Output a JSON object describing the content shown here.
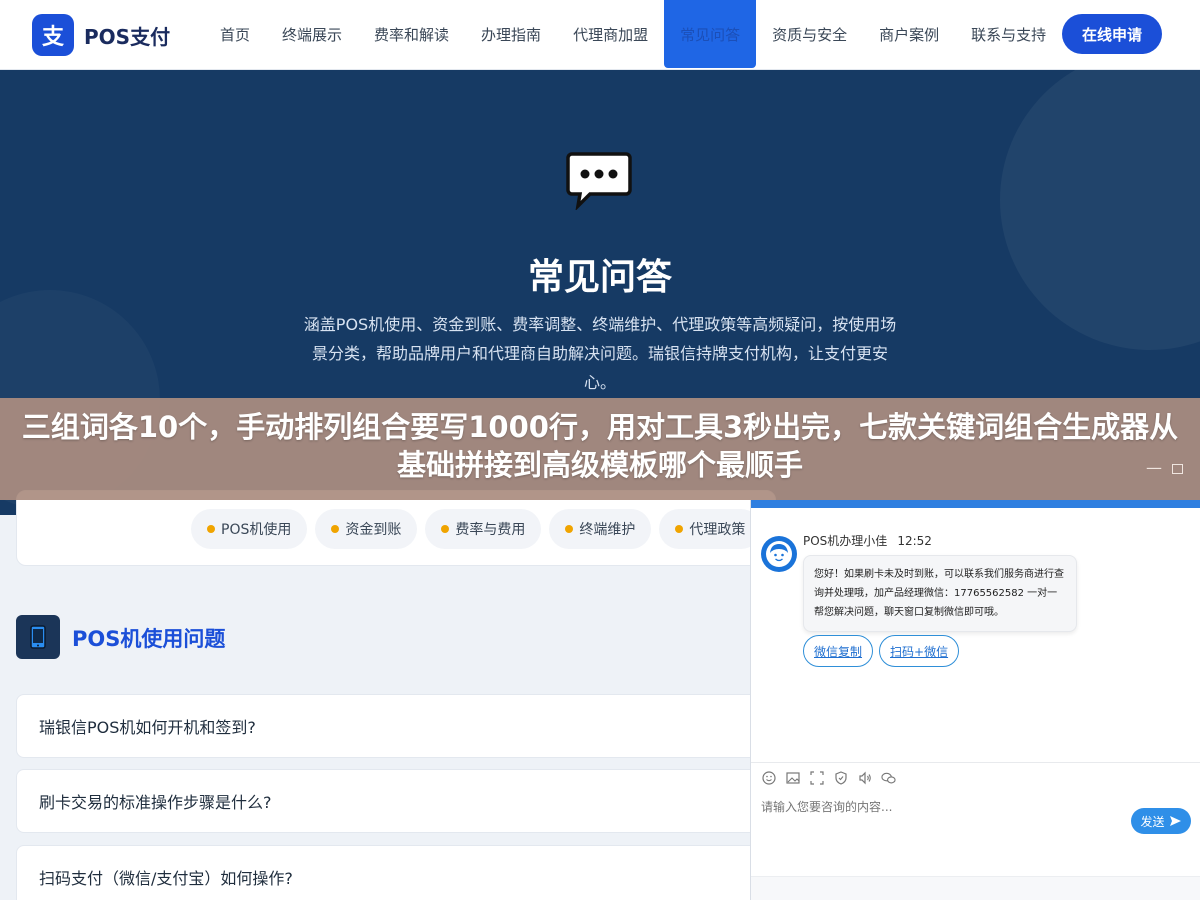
{
  "header": {
    "logo_mark": "支",
    "logo_text": "POS支付",
    "nav": [
      "首页",
      "终端展示",
      "费率和解读",
      "办理指南",
      "代理商加盟",
      "常见问答",
      "资质与安全",
      "商户案例",
      "联系与支持"
    ],
    "active_nav": "常见问答",
    "apply_label": "在线申请"
  },
  "hero": {
    "title": "常见问答",
    "description": "涵盖POS机使用、资金到账、费率调整、终端维护、代理政策等高频疑问，按使用场景分类，帮助品牌用户和代理商自助解决问题。瑞银信持牌支付机构，让支付更安心。"
  },
  "banner": {
    "text": "三组词各10个，手动排列组合要写1000行，用对工具3秒出完，七款关键词组合生成器从基础拼接到高级模板哪个最顺手",
    "minimize_glyph": "—"
  },
  "categories": [
    "POS机使用",
    "资金到账",
    "费率与费用",
    "终端维护",
    "代理政策"
  ],
  "section": {
    "title": "POS机使用问题",
    "icon": "phone-icon"
  },
  "faqs": [
    "瑞银信POS机如何开机和签到?",
    "刷卡交易的标准操作步骤是什么?",
    "扫码支付（微信/支付宝）如何操作?"
  ],
  "chat": {
    "agent_name": "POS机办理小佳",
    "time": "12:52",
    "message": "您好！如果刷卡未及时到账，可以联系我们服务商进行查询并处理哦，加产品经理微信：17765562582 一对一帮您解决问题，聊天窗口复制微信即可哦。",
    "actions": [
      "微信复制",
      "扫码+微信"
    ],
    "input_placeholder": "请输入您要咨询的内容...",
    "send_label": "发送"
  },
  "colors": {
    "brand": "#1b4fd8",
    "hero_bg": "#163a64",
    "banner_bg": "#ab8d80",
    "chip_dot": "#f0a400",
    "chat_accent": "#2f8fe8"
  }
}
